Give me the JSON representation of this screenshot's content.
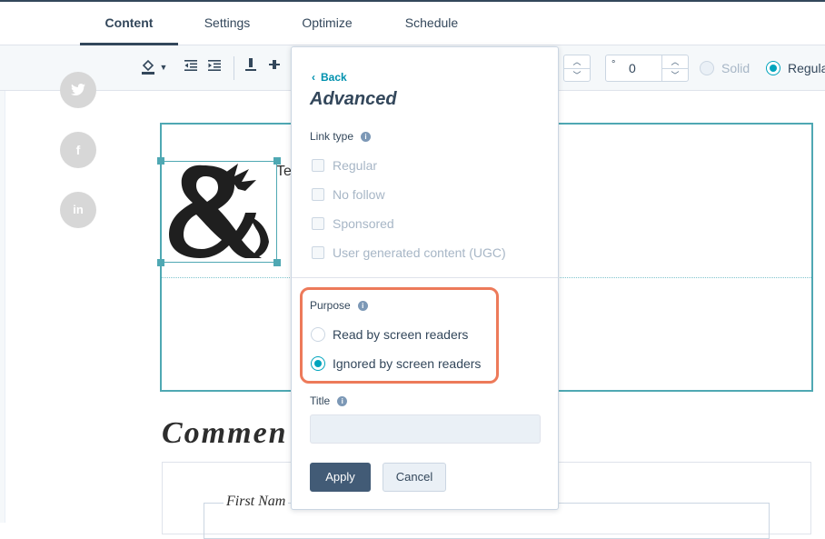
{
  "tabs": [
    {
      "label": "Content",
      "active": true
    },
    {
      "label": "Settings",
      "active": false
    },
    {
      "label": "Optimize",
      "active": false
    },
    {
      "label": "Schedule",
      "active": false
    }
  ],
  "toolbar": {
    "line_height_value": "0",
    "degree_symbol": "°",
    "border_styles": [
      {
        "label": "Solid",
        "selected": false
      },
      {
        "label": "Regular",
        "selected": true
      }
    ]
  },
  "module": {
    "text_fragment": "Te"
  },
  "comments": {
    "heading": "Commen",
    "first_name_label": "First Nam"
  },
  "popover": {
    "back_label": "Back",
    "title": "Advanced",
    "link_type_label": "Link type",
    "link_types": [
      {
        "label": "Regular",
        "checked": false
      },
      {
        "label": "No follow",
        "checked": false
      },
      {
        "label": "Sponsored",
        "checked": false
      },
      {
        "label": "User generated content (UGC)",
        "checked": false
      }
    ],
    "purpose_label": "Purpose",
    "purpose_options": [
      {
        "label": "Read by screen readers",
        "selected": false
      },
      {
        "label": "Ignored by screen readers",
        "selected": true
      }
    ],
    "title_field_label": "Title",
    "title_field_value": "",
    "apply_label": "Apply",
    "cancel_label": "Cancel"
  },
  "colors": {
    "accent": "#00a4bd",
    "highlight": "#ed7a5a",
    "primary_button": "#425b76",
    "text": "#33475b"
  }
}
